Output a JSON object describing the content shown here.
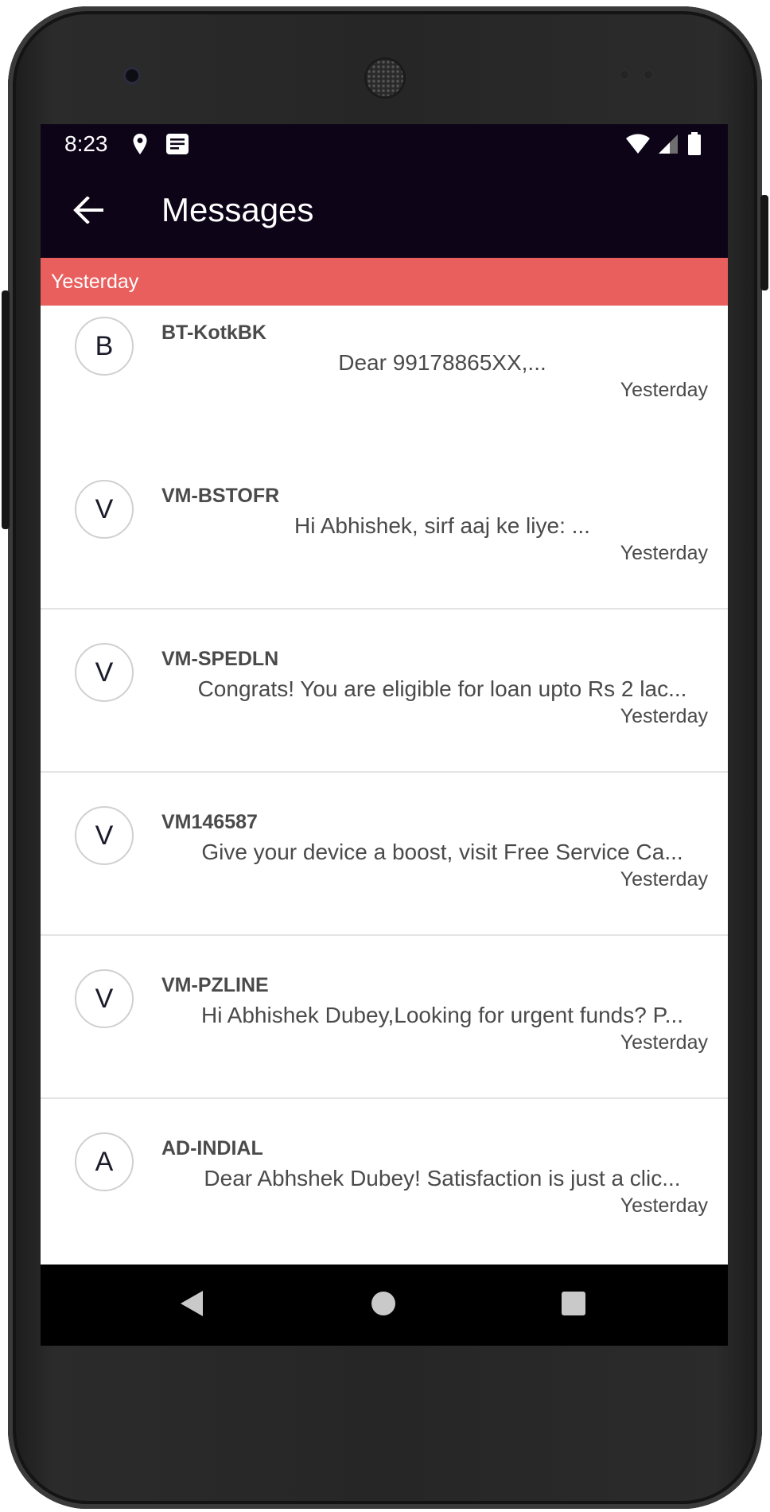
{
  "status_bar": {
    "time": "8:23",
    "icons": [
      "location-icon",
      "notes-icon",
      "wifi-icon",
      "signal-icon",
      "battery-icon"
    ]
  },
  "app_bar": {
    "back_icon": "arrow-left-icon",
    "title": "Messages"
  },
  "section_header": "Yesterday",
  "messages": [
    {
      "initial": "B",
      "sender": "BT-KotkBK",
      "preview": "Dear 99178865XX,...",
      "time": "Yesterday"
    },
    {
      "initial": "V",
      "sender": "VM-BSTOFR",
      "preview": "Hi Abhishek, sirf aaj ke liye:  ...",
      "time": "Yesterday"
    },
    {
      "initial": "V",
      "sender": "VM-SPEDLN",
      "preview": "Congrats! You are eligible for loan upto Rs 2 lac...",
      "time": "Yesterday"
    },
    {
      "initial": "V",
      "sender": "VM146587",
      "preview": "Give your device a boost, visit Free Service Ca...",
      "time": "Yesterday"
    },
    {
      "initial": "V",
      "sender": "VM-PZLINE",
      "preview": "Hi Abhishek Dubey,Looking for urgent funds? P...",
      "time": "Yesterday"
    },
    {
      "initial": "A",
      "sender": "AD-INDIAL",
      "preview": "Dear  Abhshek Dubey! Satisfaction is just a clic...",
      "time": "Yesterday"
    }
  ],
  "nav_bar": {
    "buttons": [
      "back-triangle-icon",
      "home-circle-icon",
      "recents-square-icon"
    ]
  },
  "colors": {
    "app_bar": "#0e0418",
    "section_header": "#e85f5e",
    "text": "#4a4a4a"
  }
}
